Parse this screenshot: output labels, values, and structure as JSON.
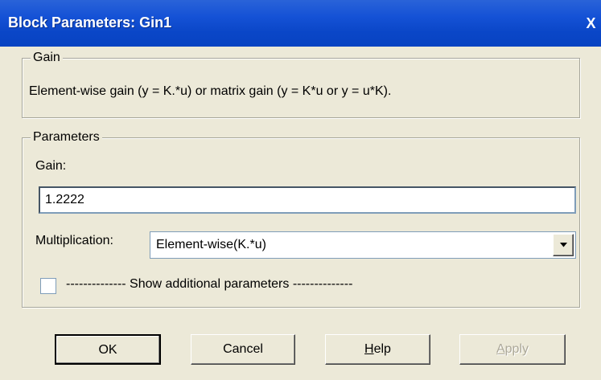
{
  "window": {
    "title": "Block Parameters: Gin1",
    "close_glyph": "X"
  },
  "gain_group": {
    "legend": "Gain",
    "description": "Element-wise gain (y = K.*u) or matrix gain (y = K*u or y = u*K)."
  },
  "params_group": {
    "legend": "Parameters",
    "gain_label": "Gain:",
    "gain_value": "1.2222",
    "multiplication_label": "Multiplication:",
    "multiplication_value": "Element-wise(K.*u)",
    "show_additional_label": "-------------- Show additional parameters --------------",
    "show_additional_checked": false
  },
  "buttons": {
    "ok": "OK",
    "cancel": "Cancel",
    "help_underlined": "H",
    "help_rest": "elp",
    "apply_underlined": "A",
    "apply_rest": "pply"
  },
  "icons": {
    "close": "close-icon",
    "dropdown": "chevron-down-icon"
  },
  "colors": {
    "titlebar": "#0a46c7",
    "dialog_bg": "#ece9d8",
    "disabled_text": "#aca899"
  }
}
